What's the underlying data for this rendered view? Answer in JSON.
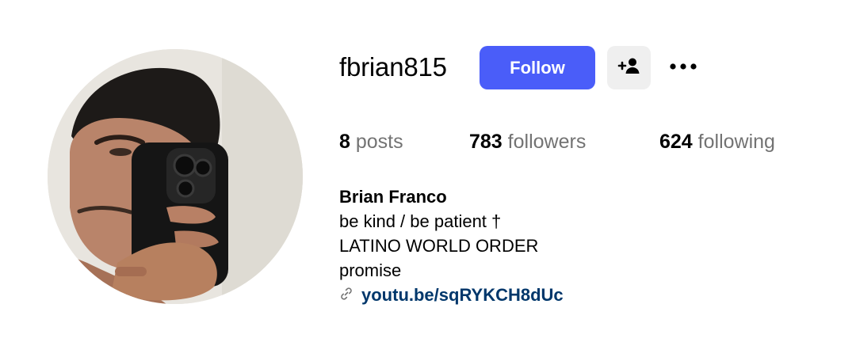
{
  "profile": {
    "username": "fbrian815",
    "follow_label": "Follow",
    "stats": {
      "posts_count": "8",
      "posts_label": "posts",
      "followers_count": "783",
      "followers_label": "followers",
      "following_count": "624",
      "following_label": "following"
    },
    "bio": {
      "full_name": "Brian Franco",
      "line1": "be kind / be patient †",
      "line2": "LATINO WORLD ORDER",
      "line3": "promise",
      "link": "youtu.be/sqRYKCH8dUc"
    }
  },
  "colors": {
    "follow_button": "#4a5df9",
    "secondary_button": "#efefef",
    "link": "#00376b",
    "muted_text": "#737373"
  },
  "icons": {
    "suggest": "person-add-icon",
    "more": "more-horizontal-icon",
    "link": "link-icon"
  }
}
